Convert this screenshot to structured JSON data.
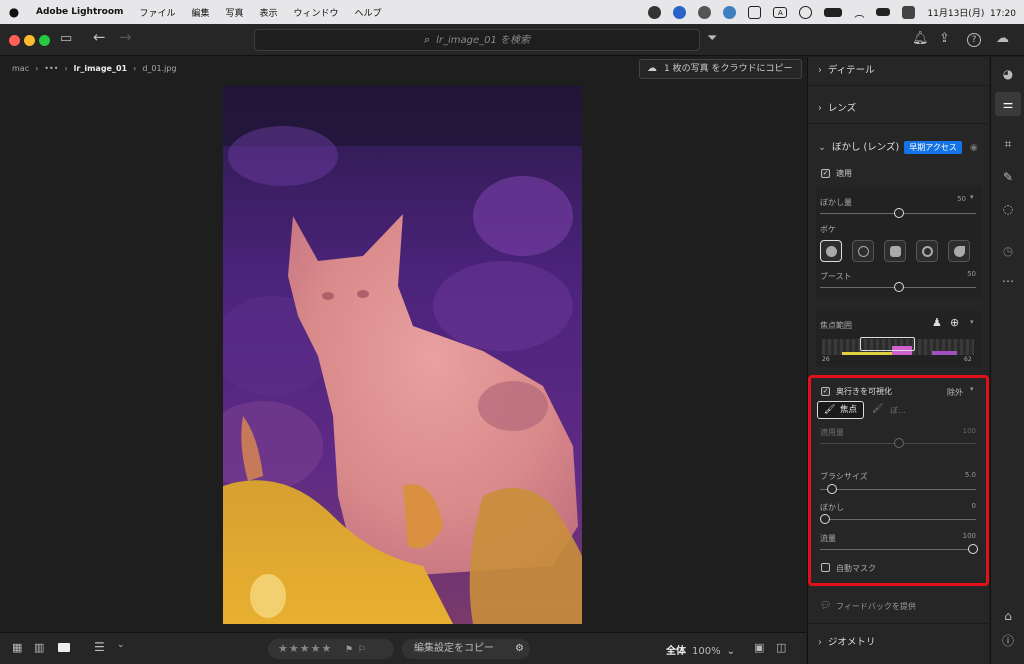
{
  "menubar": {
    "app_name": "Adobe Lightroom",
    "items": [
      "ファイル",
      "編集",
      "写真",
      "表示",
      "ウィンドウ",
      "ヘルプ"
    ],
    "datetime": "11月13日(月)  17:20",
    "status_badge": "A"
  },
  "search": {
    "placeholder": "lr_image_01 を検索"
  },
  "breadcrumb": {
    "root": "mac",
    "ellipsis": "•••",
    "album": "lr_image_01",
    "file": "d_01.jpg"
  },
  "copy_cloud_label": "1 枚の写真 をクラウドにコピー",
  "bottombar": {
    "stars": "★★★★★",
    "flags": "⚑ ⚐",
    "copy_edit": "編集設定をコピー",
    "zoom_label": "全体",
    "zoom_value": "100%"
  },
  "panel": {
    "detail": "ディテール",
    "lens": "レンズ",
    "lens_blur": "ぼかし (レンズ)",
    "early_access": "早期アクセス",
    "apply": "適用",
    "blur_amount_label": "ぼかし量",
    "blur_amount_value": "50",
    "bokeh_label": "ボケ",
    "boost_label": "ブースト",
    "boost_value": "50",
    "focus_range_label": "焦点範囲",
    "focus_range_min": "26",
    "focus_range_max": "62",
    "visualize_depth": "奥行きを可視化",
    "exclude": "除外",
    "focus_button": "焦点",
    "blur_brush": "ぼ…",
    "apply_amount_label": "適用量",
    "apply_amount_value": "100",
    "brush_size_label": "ブラシサイズ",
    "brush_size_value": "5.0",
    "feather_label": "ぼかし",
    "feather_value": "0",
    "flow_label": "流量",
    "flow_value": "100",
    "auto_mask": "自動マスク",
    "feedback": "フィードバックを提供",
    "geometry": "ジオメトリ"
  }
}
